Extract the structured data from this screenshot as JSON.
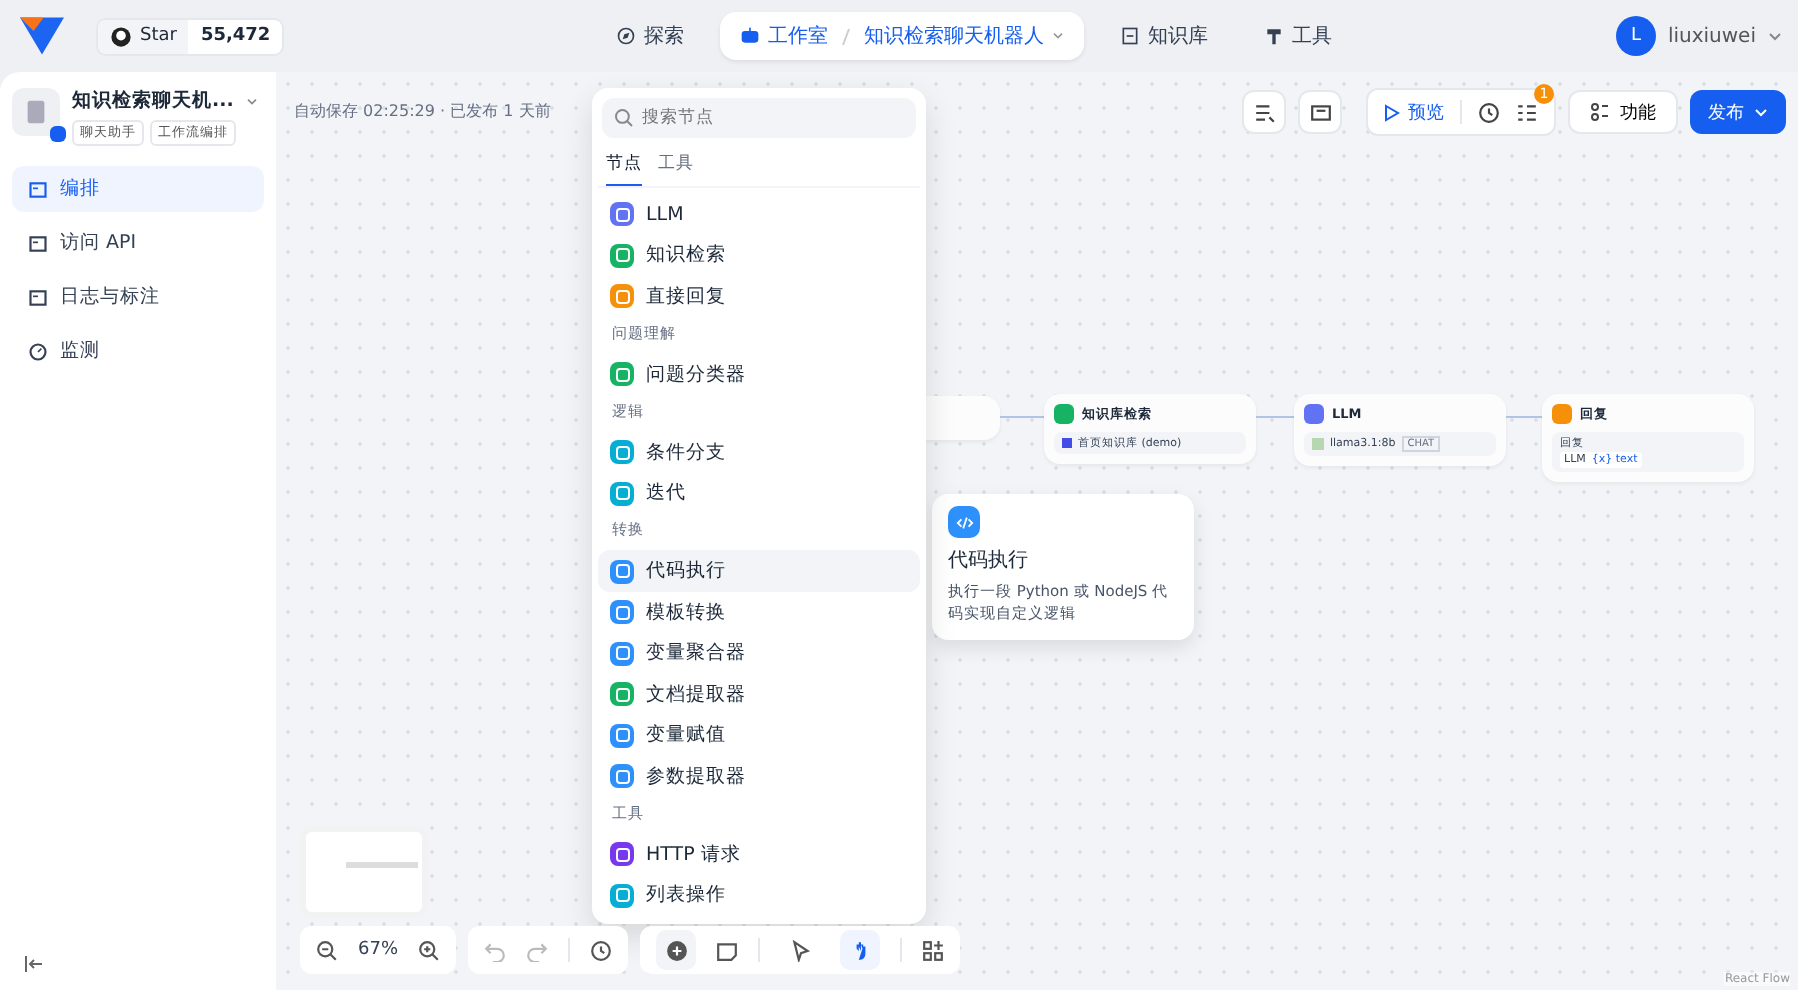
{
  "header": {
    "github": {
      "label": "Star",
      "count": "55,472"
    },
    "nav": [
      {
        "label": "探索",
        "selected": false
      },
      {
        "label": "工作室",
        "selected": true,
        "crumb": "知识检索聊天机器人"
      },
      {
        "label": "知识库",
        "selected": false
      },
      {
        "label": "工具",
        "selected": false
      }
    ],
    "user": {
      "initial": "L",
      "name": "liuxiuwei"
    }
  },
  "app": {
    "name": "知识检索聊天机...",
    "tags": [
      "聊天助手",
      "工作流编排"
    ]
  },
  "sidebar": {
    "items": [
      {
        "label": "编排",
        "selected": true
      },
      {
        "label": "访问 API",
        "selected": false
      },
      {
        "label": "日志与标注",
        "selected": false
      },
      {
        "label": "监测",
        "selected": false
      }
    ]
  },
  "save_status": "自动保存 02:25:29 · 已发布 1 天前",
  "toolbar": {
    "preview": "预览",
    "badge": "1",
    "features": "功能",
    "publish": "发布"
  },
  "node_menu": {
    "placeholder": "搜索节点",
    "tabs": [
      {
        "label": "节点",
        "selected": true
      },
      {
        "label": "工具",
        "selected": false
      }
    ],
    "items": [
      {
        "kind": "node",
        "label": "LLM",
        "color": "#6172f3",
        "selected": false
      },
      {
        "kind": "node",
        "label": "知识检索",
        "color": "#16b364",
        "selected": false
      },
      {
        "kind": "node",
        "label": "直接回复",
        "color": "#f79009",
        "selected": false
      },
      {
        "kind": "section",
        "label": "问题理解"
      },
      {
        "kind": "node",
        "label": "问题分类器",
        "color": "#16b364",
        "selected": false
      },
      {
        "kind": "section",
        "label": "逻辑"
      },
      {
        "kind": "node",
        "label": "条件分支",
        "color": "#06aed4",
        "selected": false
      },
      {
        "kind": "node",
        "label": "迭代",
        "color": "#06aed4",
        "selected": false
      },
      {
        "kind": "section",
        "label": "转换"
      },
      {
        "kind": "node",
        "label": "代码执行",
        "color": "#2e90fa",
        "selected": true
      },
      {
        "kind": "node",
        "label": "模板转换",
        "color": "#2e90fa",
        "selected": false
      },
      {
        "kind": "node",
        "label": "变量聚合器",
        "color": "#2e90fa",
        "selected": false
      },
      {
        "kind": "node",
        "label": "文档提取器",
        "color": "#16b364",
        "selected": false
      },
      {
        "kind": "node",
        "label": "变量赋值",
        "color": "#2e90fa",
        "selected": false
      },
      {
        "kind": "node",
        "label": "参数提取器",
        "color": "#2e90fa",
        "selected": false
      },
      {
        "kind": "section",
        "label": "工具"
      },
      {
        "kind": "node",
        "label": "HTTP 请求",
        "color": "#7839ee",
        "selected": false
      },
      {
        "kind": "node",
        "label": "列表操作",
        "color": "#06aed4",
        "selected": false
      }
    ]
  },
  "tooltip": {
    "title": "代码执行",
    "color": "#2e90fa",
    "description": "执行一段 Python 或 NodeJS 代码实现自定义逻辑"
  },
  "nodes": [
    {
      "kind": "hidden"
    },
    {
      "kind": "retrieval",
      "title": "知识库检索",
      "color": "#16b364",
      "detail": "首页知识库 (demo)"
    },
    {
      "kind": "llm",
      "title": "LLM",
      "color": "#6172f3",
      "detail": "llama3.1:8b",
      "tag": "CHAT"
    },
    {
      "kind": "answer",
      "title": "回复",
      "color": "#f79009",
      "label": "回复",
      "source": "LLM",
      "variable": "{x} text"
    }
  ],
  "zoom": "67%",
  "tools": [
    {
      "kind": "pointer",
      "selected": false
    },
    {
      "kind": "hand",
      "selected": true
    }
  ],
  "attribution": "React Flow"
}
